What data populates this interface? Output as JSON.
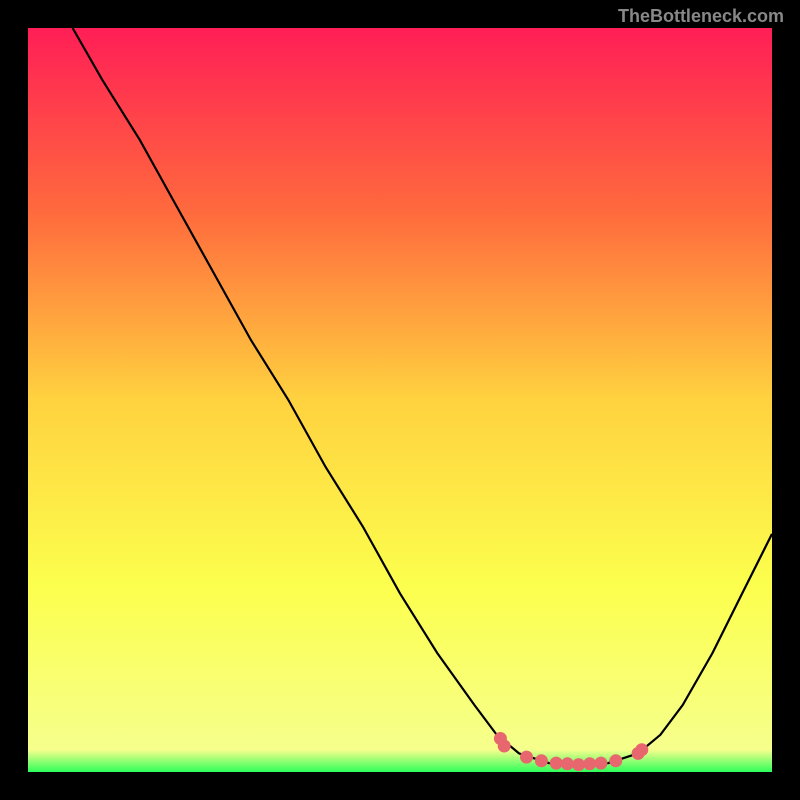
{
  "attribution": "TheBottleneck.com",
  "chart_data": {
    "type": "line",
    "title": "",
    "xlabel": "",
    "ylabel": "",
    "xlim": [
      0,
      100
    ],
    "ylim": [
      0,
      100
    ],
    "gradient_stops": [
      {
        "offset": 0,
        "color": "#ff1e56"
      },
      {
        "offset": 25,
        "color": "#ff6b3d"
      },
      {
        "offset": 50,
        "color": "#ffd23f"
      },
      {
        "offset": 75,
        "color": "#fcff4d"
      },
      {
        "offset": 97,
        "color": "#f6ff8c"
      },
      {
        "offset": 100,
        "color": "#2eff5a"
      }
    ],
    "curve": [
      {
        "x": 6,
        "y": 100
      },
      {
        "x": 10,
        "y": 93
      },
      {
        "x": 15,
        "y": 85
      },
      {
        "x": 20,
        "y": 76
      },
      {
        "x": 25,
        "y": 67
      },
      {
        "x": 30,
        "y": 58
      },
      {
        "x": 35,
        "y": 50
      },
      {
        "x": 40,
        "y": 41
      },
      {
        "x": 45,
        "y": 33
      },
      {
        "x": 50,
        "y": 24
      },
      {
        "x": 55,
        "y": 16
      },
      {
        "x": 60,
        "y": 9
      },
      {
        "x": 63,
        "y": 5
      },
      {
        "x": 66,
        "y": 2.5
      },
      {
        "x": 70,
        "y": 1.2
      },
      {
        "x": 74,
        "y": 1.0
      },
      {
        "x": 78,
        "y": 1.2
      },
      {
        "x": 82,
        "y": 2.5
      },
      {
        "x": 85,
        "y": 5
      },
      {
        "x": 88,
        "y": 9
      },
      {
        "x": 92,
        "y": 16
      },
      {
        "x": 96,
        "y": 24
      },
      {
        "x": 100,
        "y": 32
      }
    ],
    "markers": [
      {
        "x": 63.5,
        "y": 4.5
      },
      {
        "x": 64,
        "y": 3.5
      },
      {
        "x": 67,
        "y": 2.0
      },
      {
        "x": 69,
        "y": 1.5
      },
      {
        "x": 71,
        "y": 1.2
      },
      {
        "x": 72.5,
        "y": 1.1
      },
      {
        "x": 74,
        "y": 1.0
      },
      {
        "x": 75.5,
        "y": 1.1
      },
      {
        "x": 77,
        "y": 1.2
      },
      {
        "x": 79,
        "y": 1.5
      },
      {
        "x": 82,
        "y": 2.5
      },
      {
        "x": 82.5,
        "y": 3.0
      }
    ],
    "marker_color": "#e8666e"
  }
}
